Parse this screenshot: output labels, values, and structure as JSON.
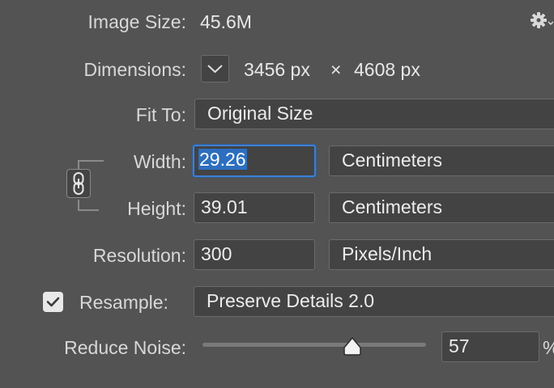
{
  "image_size": {
    "label": "Image Size:",
    "value": "45.6M"
  },
  "dimensions": {
    "label": "Dimensions:",
    "width": "3456 px",
    "times": "×",
    "height": "4608 px"
  },
  "fit_to": {
    "label": "Fit To:",
    "value": "Original Size"
  },
  "width": {
    "label": "Width:",
    "value": "29.26",
    "unit": "Centimeters"
  },
  "height": {
    "label": "Height:",
    "value": "39.01",
    "unit": "Centimeters"
  },
  "resolution": {
    "label": "Resolution:",
    "value": "300",
    "unit": "Pixels/Inch"
  },
  "resample": {
    "label": "Resample:",
    "checked": true,
    "method": "Preserve Details 2.0"
  },
  "reduce_noise": {
    "label": "Reduce Noise:",
    "value": "57",
    "unit": "%",
    "slider_fraction": 0.67
  },
  "icons": {
    "settings": "gear-icon",
    "link": "chain-link-icon",
    "checkbox": "checkmark-icon",
    "dropdown": "chevron-down-icon"
  },
  "colors": {
    "background": "#535353",
    "field": "#434343",
    "focus": "#3f7fd0"
  }
}
